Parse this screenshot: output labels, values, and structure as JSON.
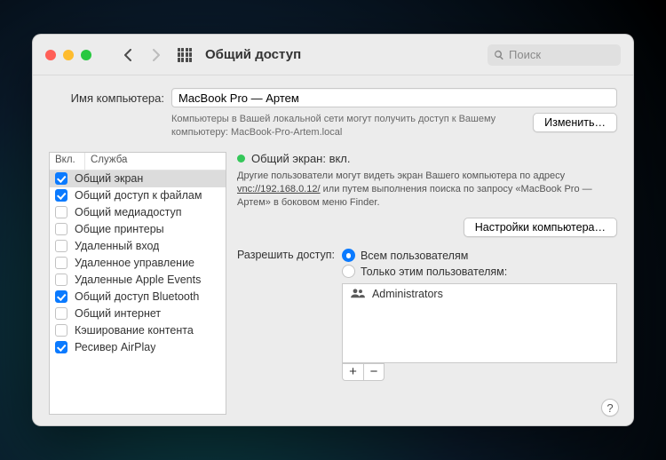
{
  "window": {
    "title": "Общий доступ",
    "search_placeholder": "Поиск"
  },
  "computer_name": {
    "label": "Имя компьютера:",
    "value": "MacBook Pro — Артем",
    "description": "Компьютеры в Вашей локальной сети могут получить доступ к Вашему компьютеру: MacBook-Pro-Artem.local",
    "edit_label": "Изменить…"
  },
  "list": {
    "col_on": "Вкл.",
    "col_service": "Служба",
    "items": [
      {
        "on": true,
        "label": "Общий экран",
        "selected": true
      },
      {
        "on": true,
        "label": "Общий доступ к файлам"
      },
      {
        "on": false,
        "label": "Общий медиадоступ"
      },
      {
        "on": false,
        "label": "Общие принтеры"
      },
      {
        "on": false,
        "label": "Удаленный вход"
      },
      {
        "on": false,
        "label": "Удаленное управление"
      },
      {
        "on": false,
        "label": "Удаленные Apple Events"
      },
      {
        "on": true,
        "label": "Общий доступ Bluetooth"
      },
      {
        "on": false,
        "label": "Общий интернет"
      },
      {
        "on": false,
        "label": "Кэширование контента"
      },
      {
        "on": true,
        "label": "Ресивер AirPlay"
      }
    ]
  },
  "detail": {
    "status_title": "Общий экран: вкл.",
    "info_pre": "Другие пользователи могут видеть экран Вашего компьютера по адресу ",
    "info_link": "vnc://192.168.0.12/",
    "info_post": " или путем выполнения поиска по запросу «MacBook Pro — Артем» в боковом меню Finder.",
    "settings_label": "Настройки компьютера…",
    "access_label": "Разрешить доступ:",
    "radio_all": "Всем пользователям",
    "radio_only": "Только этим пользователям:",
    "users": [
      {
        "name": "Administrators"
      }
    ],
    "plus": "+",
    "minus": "−"
  },
  "help": "?"
}
